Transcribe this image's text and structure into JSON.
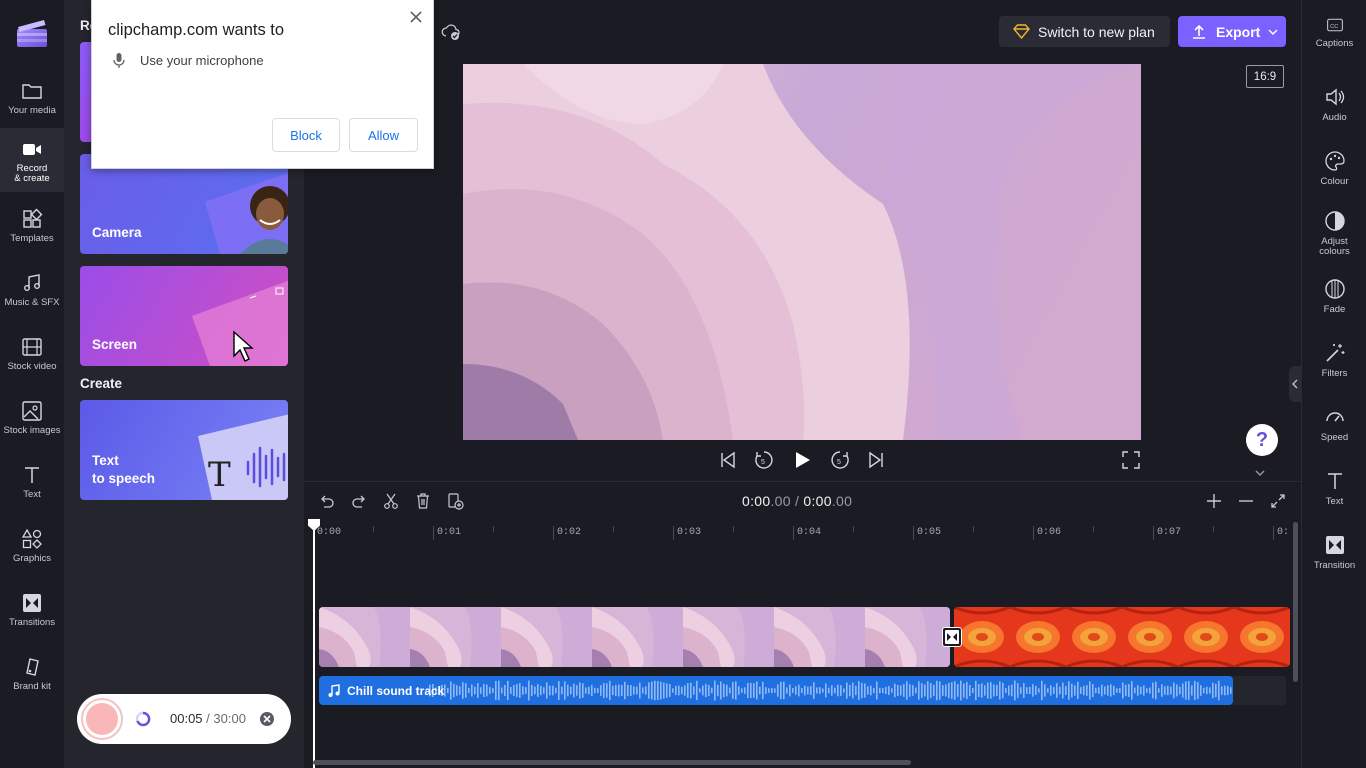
{
  "nav": {
    "items": [
      {
        "label": "Your media"
      },
      {
        "label": "Record\n& create"
      },
      {
        "label": "Templates"
      },
      {
        "label": "Music & SFX"
      },
      {
        "label": "Stock video"
      },
      {
        "label": "Stock images"
      },
      {
        "label": "Text"
      },
      {
        "label": "Graphics"
      },
      {
        "label": "Transitions"
      },
      {
        "label": "Brand kit"
      }
    ]
  },
  "panel": {
    "heading_partial": "Re",
    "cards": [
      {
        "label": "Camera"
      },
      {
        "label": "Screen"
      }
    ],
    "create_heading": "Create",
    "create_cards": [
      {
        "label_line1": "Text",
        "label_line2": "to speech"
      }
    ]
  },
  "recorder": {
    "elapsed": "00:05",
    "separator": " / ",
    "limit": "30:00"
  },
  "popup": {
    "title": "clipchamp.com wants to",
    "permission": "Use your microphone",
    "block_label": "Block",
    "allow_label": "Allow"
  },
  "topbar": {
    "switch_plan_label": "Switch to new plan",
    "export_label": "Export",
    "aspect_ratio": "16:9"
  },
  "props": {
    "items": [
      {
        "label": "Captions"
      },
      {
        "label": "Audio"
      },
      {
        "label": "Colour"
      },
      {
        "label": "Adjust\ncolours"
      },
      {
        "label": "Fade"
      },
      {
        "label": "Filters"
      },
      {
        "label": "Speed"
      },
      {
        "label": "Text"
      },
      {
        "label": "Transition"
      }
    ]
  },
  "help": {
    "label": "?"
  },
  "timeline": {
    "current_main": "0:00",
    "current_frac": ".00",
    "separator": " / ",
    "total_main": "0:00",
    "total_frac": ".00",
    "ruler": [
      "0:00",
      "0:01",
      "0:02",
      "0:03",
      "0:04",
      "0:05",
      "0:06",
      "0:07",
      "0:"
    ],
    "audio_clip_label": "Chill sound track"
  },
  "colors": {
    "accent": "#7b61ff",
    "audio_clip": "#1f6fe0",
    "background": "#1b1b23",
    "panel": "#25252e"
  }
}
